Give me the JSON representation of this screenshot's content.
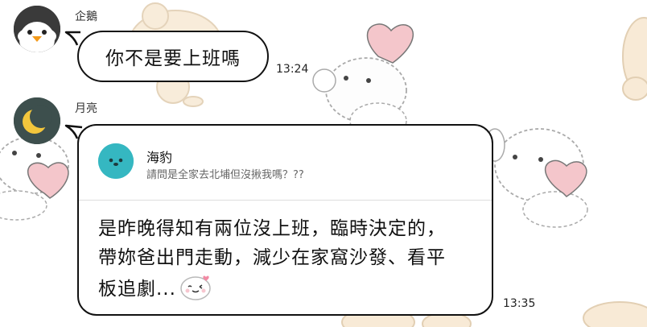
{
  "messages": [
    {
      "sender": "企鵝",
      "avatar_icon": "penguin-icon",
      "text": "你不是要上班嗎",
      "time": "13:24"
    },
    {
      "sender": "月亮",
      "avatar_icon": "crescent-moon-icon",
      "reply": {
        "name": "海豹",
        "avatar_icon": "seal-icon",
        "preview": "請問是全家去北埔但沒揪我嗎？??"
      },
      "lines": [
        "是昨晚得知有兩位沒上班，臨時決定的，",
        "帶妳爸出門走動，減少在家窩沙發、看平",
        "板追劇..."
      ],
      "emoji_icon": "smiling-rice-cake-emoji-icon",
      "time": "13:35"
    }
  ],
  "colors": {
    "bubble_border": "#111111",
    "moon_avatar_bg": "#3d4f4d",
    "moon": "#f3c63c",
    "seal_avatar_bg": "#35b7c1",
    "penguin_dark": "#3a3a3a",
    "penguin_beak": "#f39a1a",
    "wallpaper_heart": "#f2c2c8",
    "wallpaper_character": "#f6e6d0"
  }
}
